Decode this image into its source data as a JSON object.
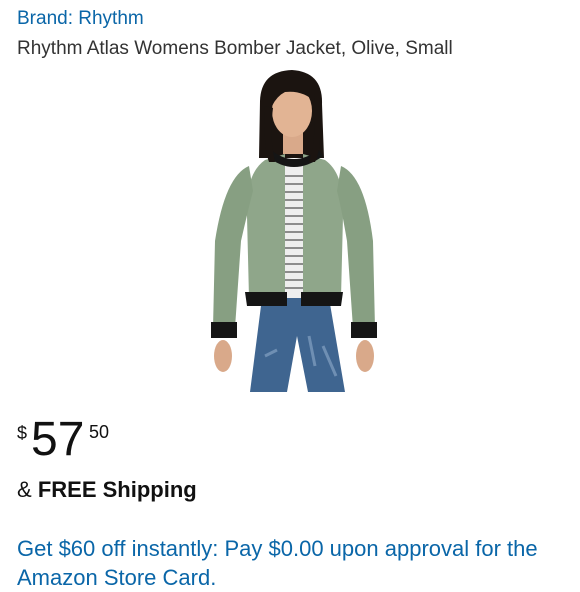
{
  "brand_link": "Brand: Rhythm",
  "product_title": "Rhythm Atlas Womens Bomber Jacket, Olive, Small",
  "price": {
    "currency_symbol": "$",
    "whole": "57",
    "fraction": "50"
  },
  "shipping": {
    "prefix": "&",
    "label": "FREE Shipping"
  },
  "promo_text": "Get $60 off instantly: Pay $0.00 upon approval for the Amazon Store Card.",
  "colors": {
    "link": "#0a66a8",
    "jacket": "#8fa68a",
    "cuffs": "#151515",
    "jeans": "#3f6590"
  }
}
